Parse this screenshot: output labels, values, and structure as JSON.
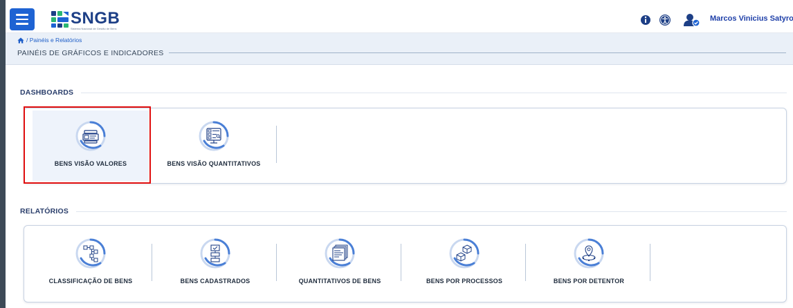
{
  "header": {
    "logo_text": "SNGB",
    "logo_subtitle": "Sistema Nacional de Gestão de Bens",
    "user_name": "Marcos Vinicius Satyro C..."
  },
  "breadcrumb": {
    "home_icon": "home-icon",
    "path": "/ Painéis e Relatórios"
  },
  "page": {
    "title": "PAINÉIS DE GRÁFICOS E INDICADORES"
  },
  "dashboards": {
    "label": "DASHBOARDS",
    "items": [
      {
        "label": "BENS VISÃO VALORES",
        "icon": "server-screen-icon",
        "selected": true
      },
      {
        "label": "BENS VISÃO QUANTITATIVOS",
        "icon": "monitor-report-icon",
        "selected": false
      }
    ]
  },
  "relatorios": {
    "label": "RELATÓRIOS",
    "items": [
      {
        "label": "CLASSIFICAÇÃO DE BENS",
        "icon": "hierarchy-icon"
      },
      {
        "label": "BENS CADASTRADOS",
        "icon": "clipboard-flow-icon"
      },
      {
        "label": "QUANTITATIVOS DE BENS",
        "icon": "stacked-documents-icon"
      },
      {
        "label": "BENS POR PROCESSOS",
        "icon": "boxes-icon"
      },
      {
        "label": "BENS POR DETENTOR",
        "icon": "location-user-icon"
      }
    ]
  },
  "colors": {
    "accent": "#1e63d3",
    "icon_ring": "#4a7fd6",
    "highlight": "#e00d0d"
  }
}
